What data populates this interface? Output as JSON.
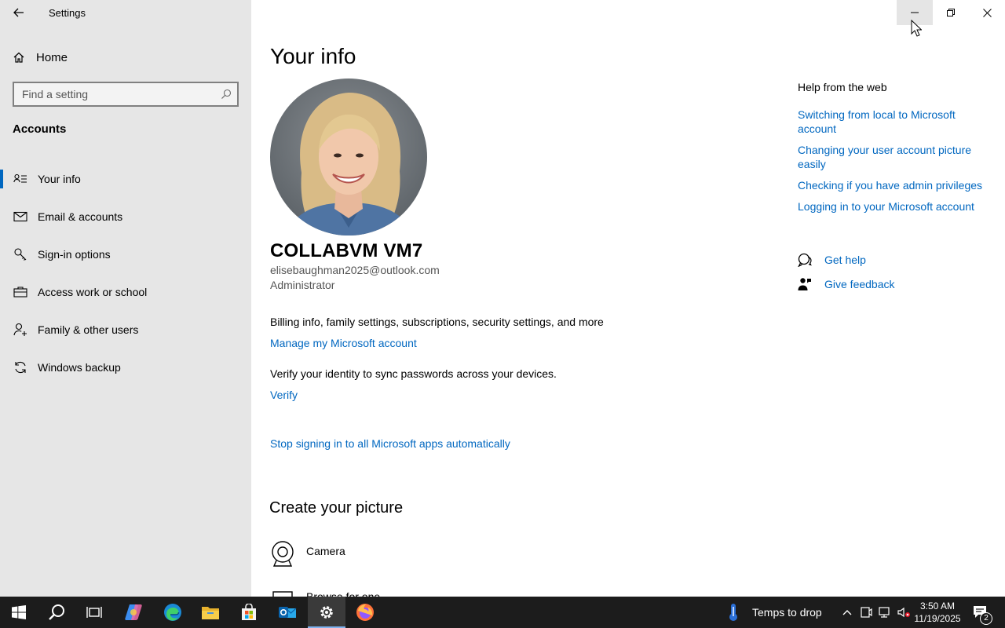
{
  "window": {
    "title": "Settings",
    "minimize_icon": "minimize-icon",
    "maximize_icon": "restore-icon",
    "close_icon": "close-icon"
  },
  "sidebar": {
    "home_label": "Home",
    "search_placeholder": "Find a setting",
    "section_title": "Accounts",
    "items": [
      {
        "label": "Your info",
        "icon": "contact-card-icon",
        "active": true
      },
      {
        "label": "Email & accounts",
        "icon": "mail-icon",
        "active": false
      },
      {
        "label": "Sign-in options",
        "icon": "key-icon",
        "active": false
      },
      {
        "label": "Access work or school",
        "icon": "briefcase-icon",
        "active": false
      },
      {
        "label": "Family & other users",
        "icon": "add-person-icon",
        "active": false
      },
      {
        "label": "Windows backup",
        "icon": "sync-icon",
        "active": false
      }
    ]
  },
  "main": {
    "title": "Your info",
    "user": {
      "name": "COLLABVM VM7",
      "email": "elisebaughman2025@outlook.com",
      "role": "Administrator"
    },
    "billing_text": "Billing info, family settings, subscriptions, security settings, and more",
    "manage_link": "Manage my Microsoft account",
    "verify_text": "Verify your identity to sync passwords across your devices.",
    "verify_link": "Verify",
    "stop_link": "Stop signing in to all Microsoft apps automatically",
    "create_picture_title": "Create your picture",
    "options": [
      {
        "label": "Camera",
        "icon": "camera-icon"
      },
      {
        "label": "Browse for one",
        "icon": "browse-icon"
      }
    ]
  },
  "help": {
    "title": "Help from the web",
    "links": [
      "Switching from local to Microsoft account",
      "Changing your user account picture easily",
      "Checking if you have admin privileges",
      "Logging in to your Microsoft account"
    ],
    "get_help": "Get help",
    "give_feedback": "Give feedback"
  },
  "taskbar": {
    "weather_text": "Temps to drop",
    "time": "3:50 AM",
    "date": "11/19/2025",
    "notification_count": "2",
    "apps": [
      "start-icon",
      "search-icon",
      "task-view-icon",
      "copilot-icon",
      "edge-icon",
      "file-explorer-icon",
      "store-icon",
      "outlook-icon",
      "settings-icon",
      "firefox-icon"
    ]
  },
  "colors": {
    "accent": "#0067c0",
    "sidebar_bg": "#e6e6e6",
    "taskbar_bg": "#1c1c1c"
  }
}
